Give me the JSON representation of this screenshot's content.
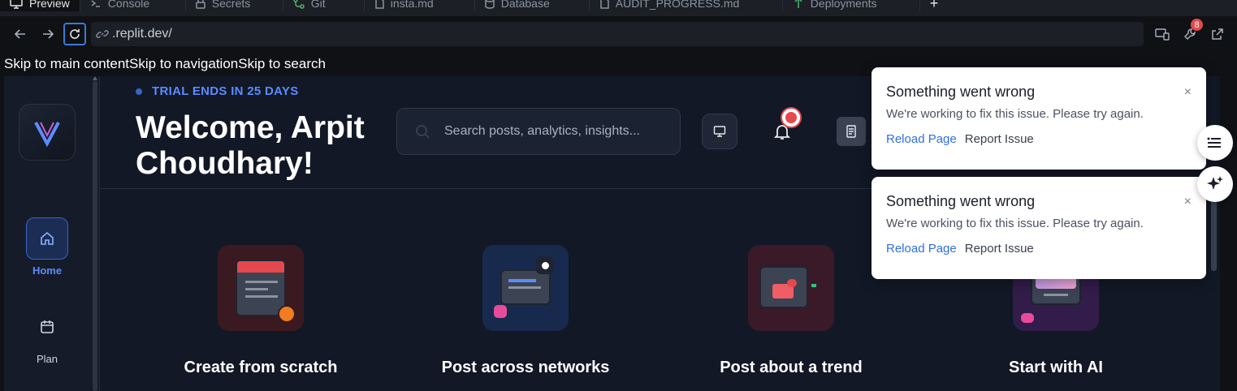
{
  "ide_tabs": [
    {
      "label": "Preview",
      "icon": "monitor-icon",
      "active": true
    },
    {
      "label": "Console",
      "icon": "terminal-icon",
      "active": false
    },
    {
      "label": "Secrets",
      "icon": "lock-icon",
      "active": false
    },
    {
      "label": "Git",
      "icon": "git-icon",
      "active": false
    },
    {
      "label": "insta.md",
      "icon": "file-icon",
      "active": false
    },
    {
      "label": "Database",
      "icon": "database-icon",
      "active": false
    },
    {
      "label": "AUDIT_PROGRESS.md",
      "icon": "file-icon",
      "active": false
    },
    {
      "label": "Deployments",
      "icon": "deploy-icon",
      "active": false
    }
  ],
  "new_tab": "+",
  "browser": {
    "url": ".replit.dev/",
    "notifications_count": "8"
  },
  "skip_links": {
    "main": "Skip to main content",
    "nav": "Skip to navigation",
    "search": "Skip to search"
  },
  "sidebar": {
    "items": [
      {
        "label": "Home",
        "icon": "home-icon",
        "active": true
      },
      {
        "label": "Plan",
        "icon": "calendar-icon",
        "active": false
      }
    ]
  },
  "header": {
    "trial": "TRIAL ENDS IN 25 DAYS",
    "welcome": "Welcome, Arpit Choudhary!",
    "search_placeholder": "Search posts, analytics, insights..."
  },
  "cards": [
    {
      "label": "Create from scratch",
      "tile_color": "#3a1a20"
    },
    {
      "label": "Post across networks",
      "tile_color": "#172a4d"
    },
    {
      "label": "Post about a trend",
      "tile_color": "#3a1a28"
    },
    {
      "label": "Start with AI",
      "tile_color": "#321c4a"
    }
  ],
  "toasts": [
    {
      "title": "Something went wrong",
      "message": "We're working to fix this issue. Please try again.",
      "reload": "Reload Page",
      "report": "Report Issue",
      "close": "×"
    },
    {
      "title": "Something went wrong",
      "message": "We're working to fix this issue. Please try again.",
      "reload": "Reload Page",
      "report": "Report Issue",
      "close": "×"
    }
  ],
  "colors": {
    "accent": "#3b63c4",
    "link": "#2f6fe4",
    "danger": "#e5484d",
    "page_bg": "#121826"
  }
}
